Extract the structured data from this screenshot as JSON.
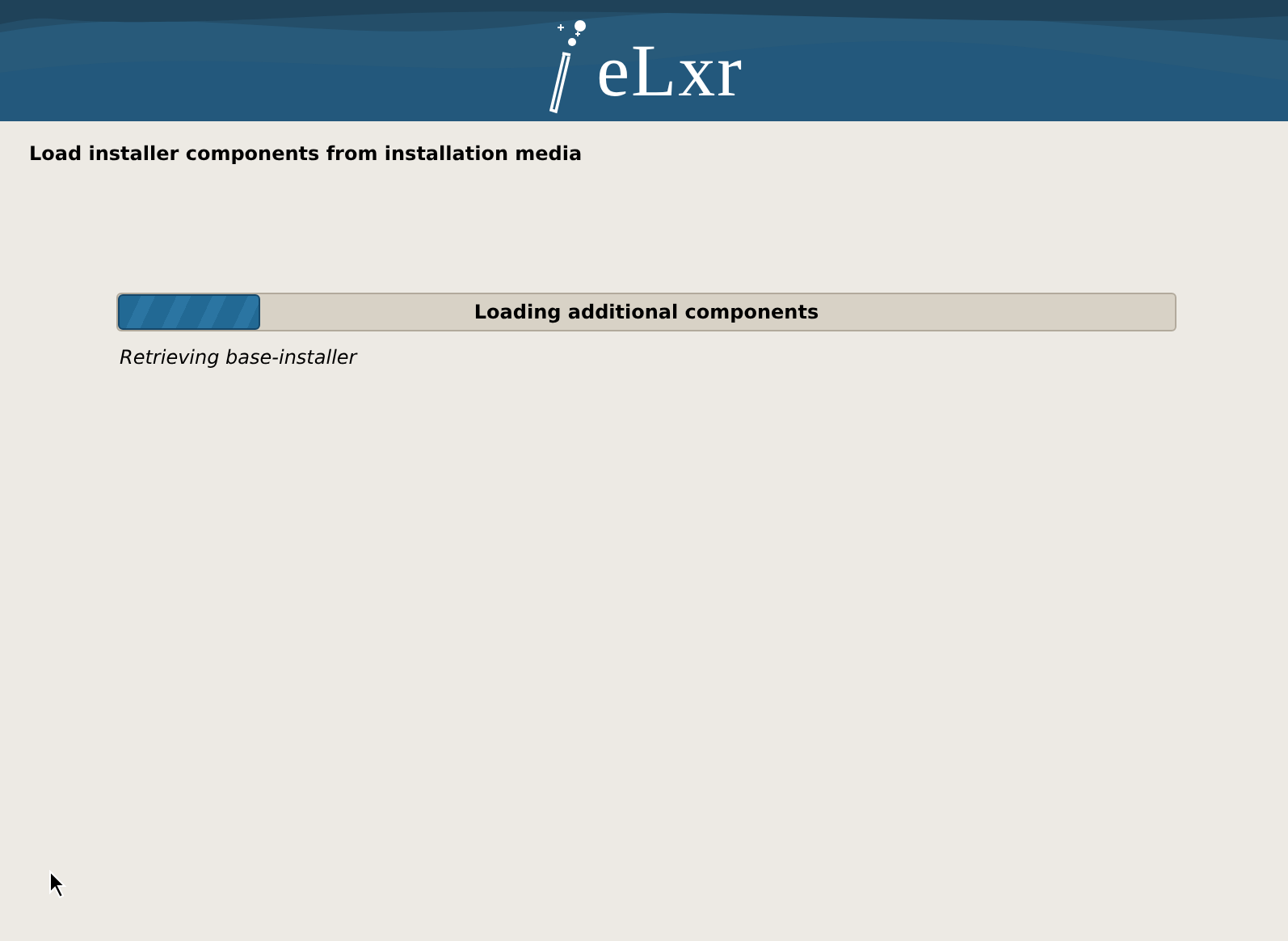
{
  "header": {
    "logo_text": "eLxr"
  },
  "title": "Load installer components from installation media",
  "progress": {
    "label": "Loading additional components",
    "level": 0.135,
    "status": "Retrieving base-installer"
  }
}
